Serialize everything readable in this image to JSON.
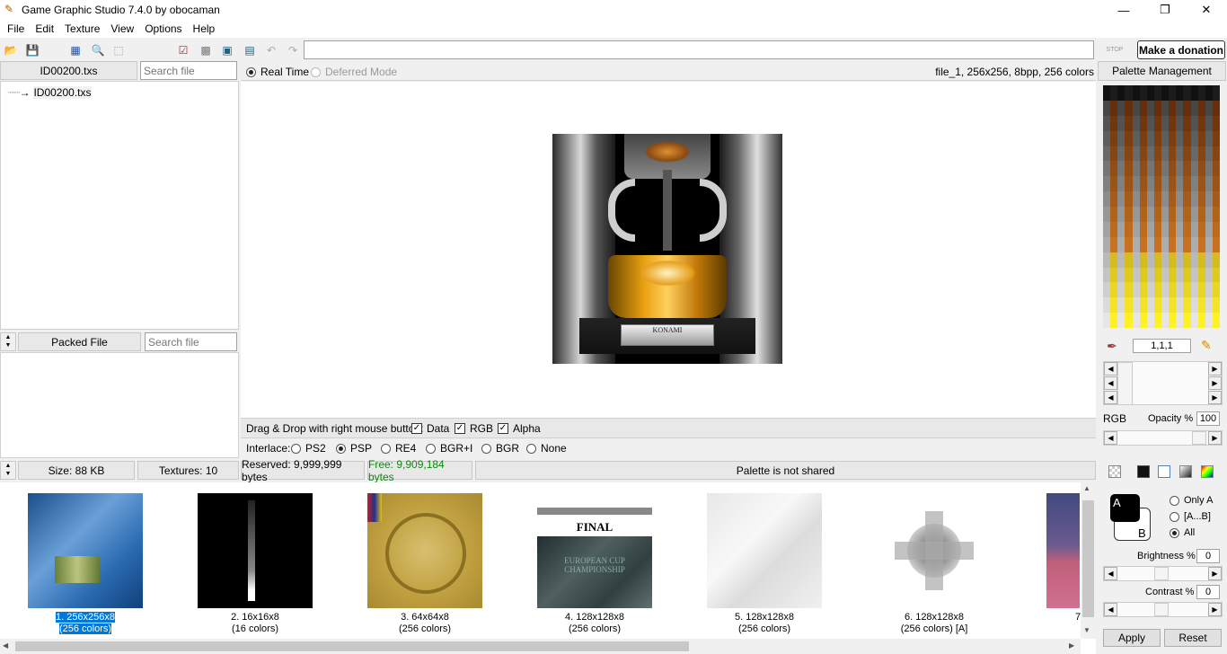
{
  "window": {
    "title": "Game Graphic Studio 7.4.0 by obocaman",
    "minimize": "—",
    "maximize": "❐",
    "close": "✕"
  },
  "menu": [
    "File",
    "Edit",
    "Texture",
    "View",
    "Options",
    "Help"
  ],
  "toolbar": {
    "path_value": "",
    "stop_label": "STOP",
    "donate_label": "Make a donation"
  },
  "left_panel": {
    "file_tab": "ID00200.txs",
    "search_placeholder": "Search file",
    "tree_item": "ID00200.txs",
    "packed_tab": "Packed File",
    "packed_search_placeholder": "Search file",
    "size_label": "Size: 88 KB",
    "textures_label": "Textures: 10"
  },
  "preview": {
    "mode_realtime": "Real Time",
    "mode_deferred": "Deferred Mode",
    "file_info": "file_1, 256x256, 8bpp, 256 colors",
    "dragdrop_label": "Drag & Drop with right mouse button:",
    "dd_data": "Data",
    "dd_rgb": "RGB",
    "dd_alpha": "Alpha",
    "interlace_label": "Interlace:",
    "interlace_options": [
      "PS2",
      "PSP",
      "RE4",
      "BGR+I",
      "BGR",
      "None"
    ],
    "interlace_selected": "PSP",
    "trophy_plate": "KONAMI"
  },
  "status": {
    "reserved": "Reserved: 9,999,999 bytes",
    "free": "Free: 9,909,184 bytes",
    "palette_shared": "Palette is not shared"
  },
  "thumbnails": [
    {
      "line1": "1. 256x256x8",
      "line2": "(256 colors)",
      "selected": true
    },
    {
      "line1": "2. 16x16x8",
      "line2": "(16 colors)"
    },
    {
      "line1": "3. 64x64x8",
      "line2": "(256 colors)"
    },
    {
      "line1": "4. 128x128x8",
      "line2": "(256 colors)",
      "title_text": "FINAL",
      "sub_text": "EUROPEAN CUP CHAMPIONSHIP"
    },
    {
      "line1": "5. 128x128x8",
      "line2": "(256 colors)"
    },
    {
      "line1": "6. 128x128x8",
      "line2": "(256 colors) [A]"
    },
    {
      "line1": "7",
      "line2": ""
    }
  ],
  "palette": {
    "header": "Palette Management",
    "color_value": "1,1,1",
    "rgb_label": "RGB",
    "opacity_label": "Opacity %",
    "opacity_value": "100",
    "label_a": "A",
    "label_b": "B",
    "only_a": "Only A",
    "range_ab": "[A...B]",
    "all": "All",
    "brightness_label": "Brightness %",
    "brightness_value": "0",
    "contrast_label": "Contrast %",
    "contrast_value": "0",
    "apply": "Apply",
    "reset": "Reset"
  }
}
